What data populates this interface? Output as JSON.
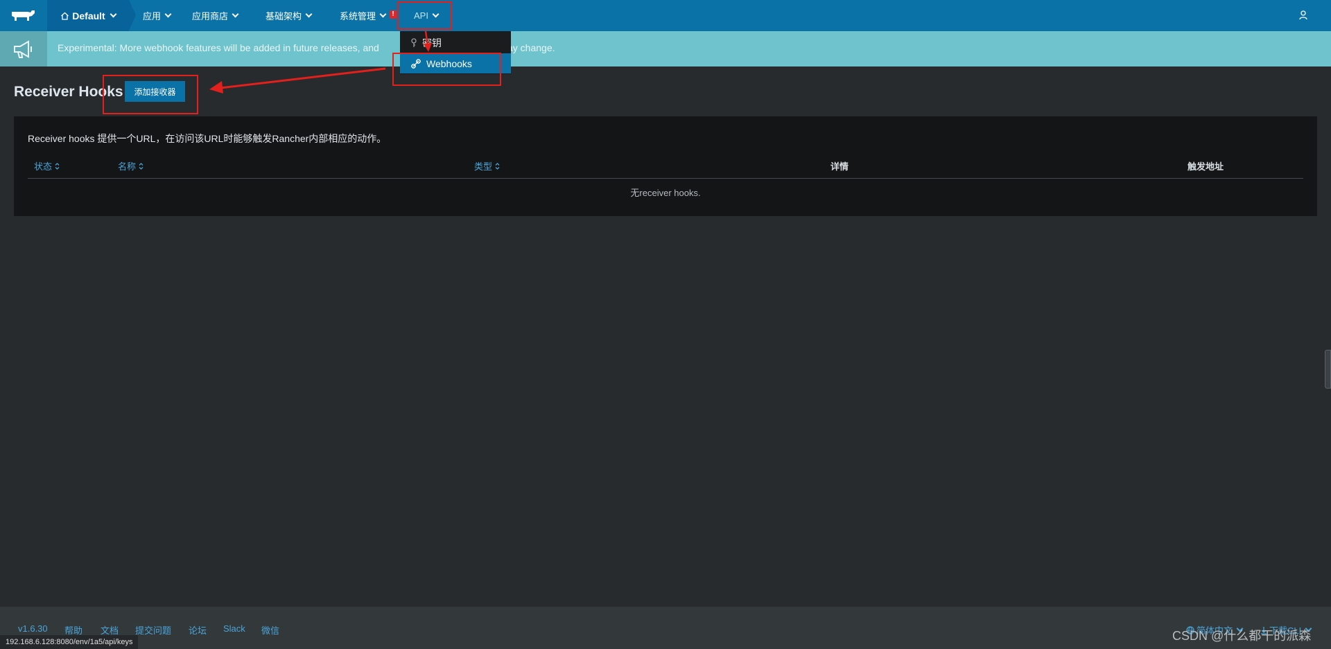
{
  "nav": {
    "env_label": "Default",
    "items": [
      "应用",
      "应用商店",
      "基础架构",
      "系统管理"
    ],
    "alert_badge": "!",
    "api_label": "API"
  },
  "banner": {
    "text_left": "Experimental: More webhook features will be added in future releases, and",
    "text_right": "ay change."
  },
  "api_menu": {
    "items": [
      "密钥",
      "Webhooks"
    ],
    "active": "Webhooks"
  },
  "page": {
    "title": "Receiver Hooks",
    "add_button": "添加接收器",
    "description": "Receiver hooks 提供一个URL，在访问该URL时能够触发Rancher内部相应的动作。",
    "columns": [
      "状态",
      "名称",
      "类型",
      "详情",
      "触发地址"
    ],
    "empty_message": "无receiver hooks."
  },
  "footer": {
    "version": "v1.6.30",
    "links": [
      "帮助",
      "文档",
      "提交问题",
      "论坛",
      "Slack",
      "微信"
    ],
    "language": "简体中文",
    "download": "下载CLI"
  },
  "status_url": "192.168.6.128:8080/env/1a5/api/keys",
  "watermark": "CSDN @什么都干的派森",
  "colors": {
    "nav_bg": "#0a72a6",
    "banner_bg": "#6fc3cd",
    "page_bg": "#272b2e",
    "panel_bg": "#141516",
    "link": "#4aa5d9",
    "annotation": "#e3201b"
  }
}
